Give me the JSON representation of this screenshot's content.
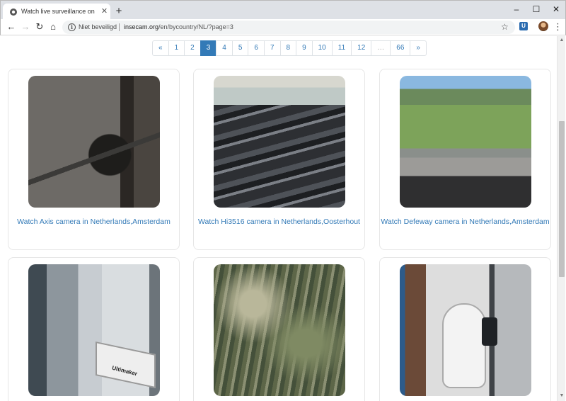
{
  "browser": {
    "tab_title": "Watch live surveillance online IP",
    "security_label": "Niet beveiligd",
    "url_host": "insecam.org",
    "url_path": "/en/bycountry/NL/?page=3"
  },
  "pagination": {
    "items": [
      "«",
      "1",
      "2",
      "3",
      "4",
      "5",
      "6",
      "7",
      "8",
      "9",
      "10",
      "11",
      "12",
      "…",
      "66",
      "»"
    ],
    "active": "3"
  },
  "cameras": [
    {
      "label": "Watch Axis camera in Netherlands,Amsterdam"
    },
    {
      "label": "Watch Hi3516 camera in Netherlands,Oosterhout"
    },
    {
      "label": "Watch Defeway camera in Netherlands,Amsterdam"
    },
    {
      "label": ""
    },
    {
      "label": ""
    },
    {
      "label": ""
    }
  ],
  "image_text": {
    "cam4_printer_brand": "Ultimaker"
  },
  "colors": {
    "link": "#337ab7",
    "active_page_bg": "#337ab7"
  }
}
